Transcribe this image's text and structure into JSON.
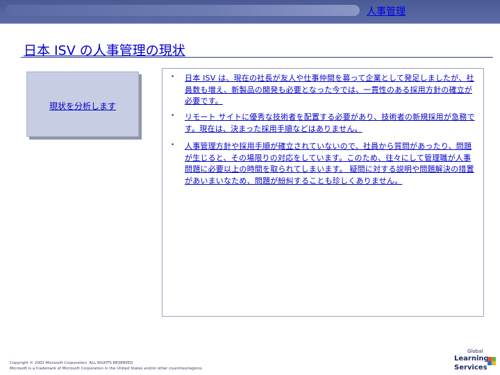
{
  "header": {
    "label": "人事管理"
  },
  "title": "日本 ISV の人事管理の現状",
  "side_box": {
    "label": "現状を分析します"
  },
  "bullets": [
    {
      "text": "日本 ISV は、現在の社長が友人や仕事仲間を募って企業として発足しましたが、社員数も増え、新製品の開発も必要となった今では、一貫性のある採用方針の確立が必要です。"
    },
    {
      "text": "リモート サイトに優秀な技術者を配置する必要があり、技術者の新規採用が急務です。現在は、決まった採用手順などはありません。"
    },
    {
      "text": "人事管理方針や採用手順が確立されていないので、社員から質問があったり、問題が生じると、その場限りの対応をしています。このため、往々にして管理職が人事問題に必要以上の時間を取られてしまいます。 疑問に対する説明や問題解決の措置があいまいなため、問題が紛糾することも珍しくありません。"
    }
  ],
  "footer": {
    "line1": "Copyright © 2002 Microsoft Corporation. ALL RIGHTS RESERVED",
    "line2": "Microsoft is a trademark of Microsoft Corporation in the United States and/or other countries/regions"
  },
  "logo": {
    "line1": "Global",
    "line2": "Learning",
    "line3": "Services"
  },
  "colors": {
    "band": "#4a5a94",
    "link": "#0000cc",
    "box": "#c7cde2"
  }
}
